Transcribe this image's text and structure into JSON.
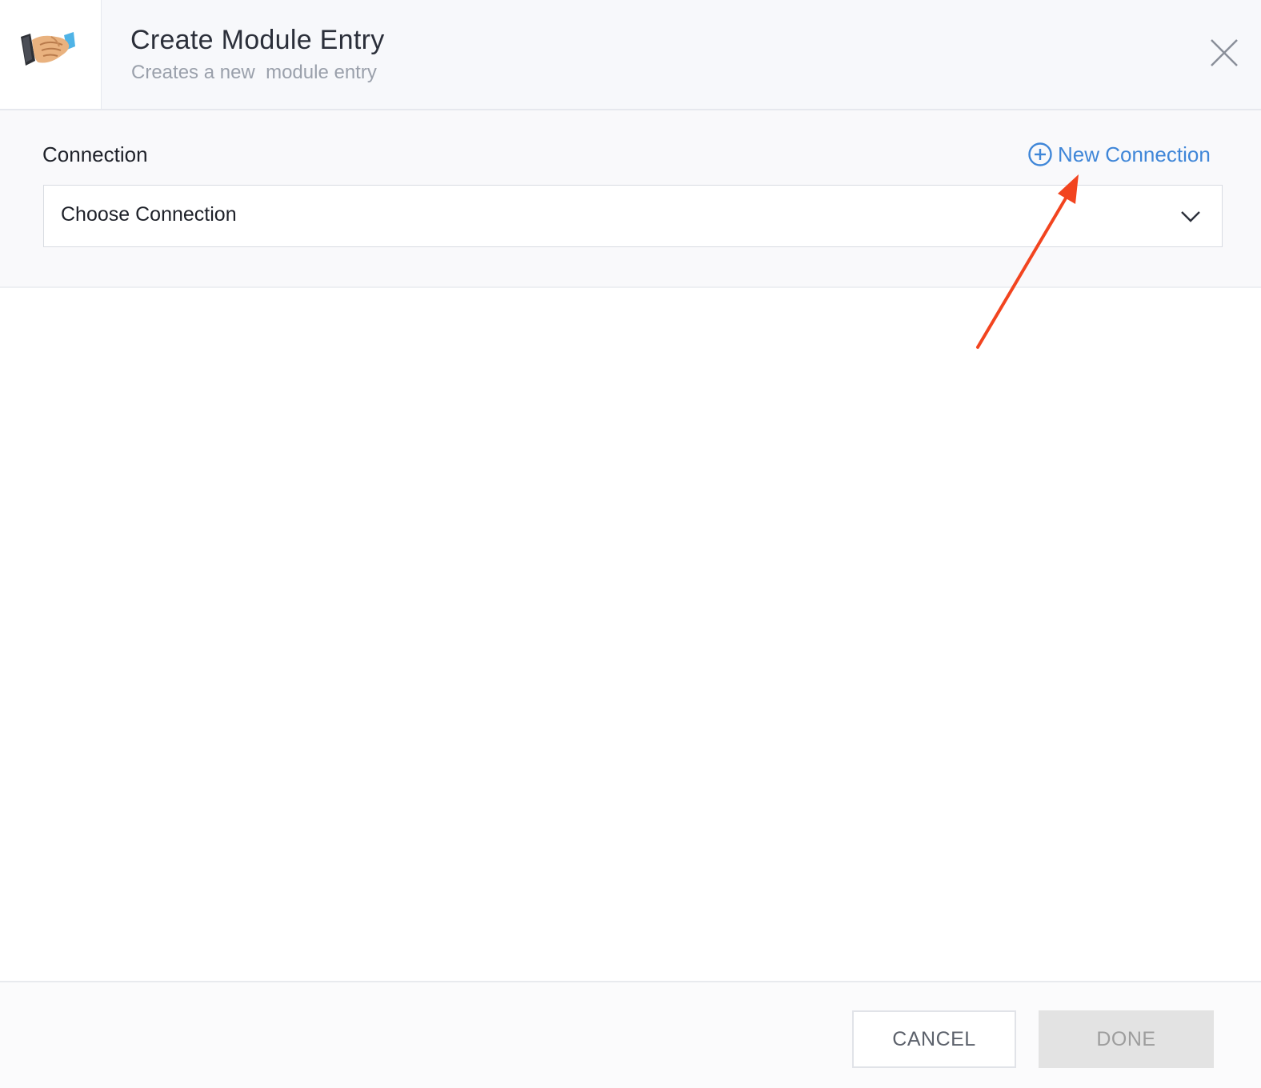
{
  "header": {
    "title": "Create Module Entry",
    "subtitle": "Creates a new  module entry",
    "logo_icon": "handshake-icon",
    "close_icon": "close-icon"
  },
  "connection": {
    "label": "Connection",
    "new_connection_label": "New Connection",
    "new_connection_icon": "plus-circle-icon",
    "select_value": "Choose Connection",
    "select_icon": "chevron-down-icon"
  },
  "footer": {
    "cancel_label": "CANCEL",
    "done_label": "DONE"
  },
  "colors": {
    "accent": "#3f86d8",
    "annotation": "#f2441f",
    "done_disabled_bg": "#e3e3e3"
  }
}
